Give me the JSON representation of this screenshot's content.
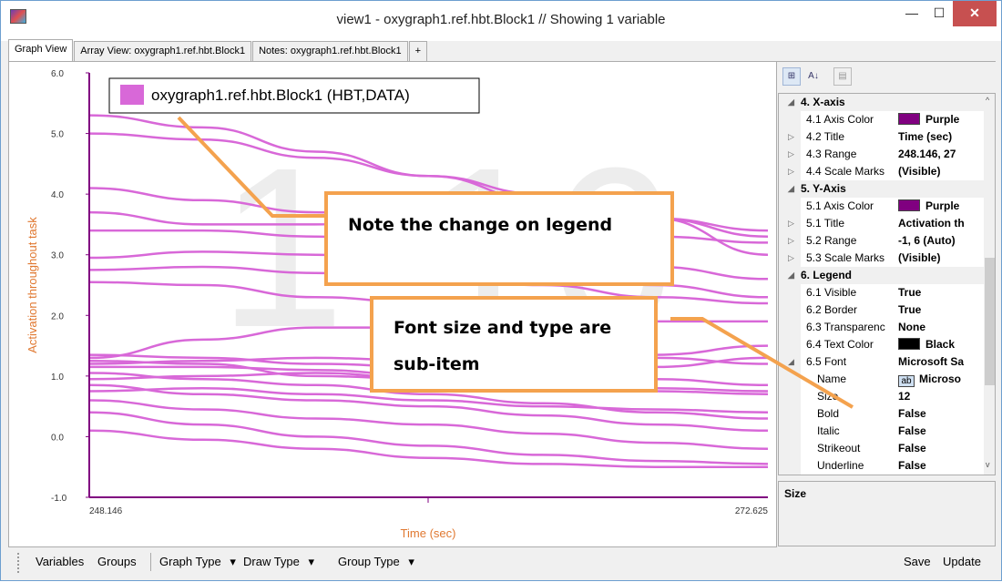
{
  "window": {
    "title": "view1 - oxygraph1.ref.hbt.Block1 // Showing 1 variable",
    "minimize": "—",
    "maximize": "☐",
    "close": "✕"
  },
  "tabs": [
    {
      "label": "Graph View"
    },
    {
      "label": "Array View: oxygraph1.ref.hbt.Block1"
    },
    {
      "label": "Notes: oxygraph1.ref.hbt.Block1"
    },
    {
      "label": "+"
    }
  ],
  "chart_data": {
    "type": "line",
    "legend_label": "oxygraph1.ref.hbt.Block1 (HBT,DATA)",
    "legend_placement": "top-left",
    "xlabel": "Time (sec)",
    "ylabel": "Activation throughout task",
    "x_ticks": [
      "248.146",
      "272.625"
    ],
    "y_ticks": [
      "6.0",
      "5.0",
      "4.0",
      "3.0",
      "2.0",
      "1.0",
      "0.0",
      "-1.0"
    ],
    "xlim": [
      248.146,
      272.625
    ],
    "ylim": [
      -1,
      6
    ],
    "watermark": "1-16",
    "line_color": "#d868d8",
    "axis_color": "#800080",
    "series": [
      {
        "values": [
          5.3,
          5.1,
          4.7,
          4.3,
          3.9,
          3.6,
          3.4
        ]
      },
      {
        "values": [
          5.0,
          4.9,
          4.6,
          4.3,
          4.0,
          3.6,
          3.0
        ]
      },
      {
        "values": [
          4.1,
          3.9,
          3.7,
          3.6,
          3.5,
          3.3,
          3.2
        ]
      },
      {
        "values": [
          3.7,
          3.5,
          3.5,
          3.7,
          3.9,
          3.6,
          3.3
        ]
      },
      {
        "values": [
          3.4,
          3.4,
          3.3,
          3.1,
          3.0,
          2.8,
          2.6
        ]
      },
      {
        "values": [
          2.95,
          3.05,
          3.0,
          2.9,
          2.7,
          2.5,
          2.3
        ]
      },
      {
        "values": [
          2.75,
          2.8,
          2.7,
          2.6,
          2.5,
          2.3,
          2.2
        ]
      },
      {
        "values": [
          2.55,
          2.5,
          2.3,
          2.2,
          2.0,
          1.9,
          1.9
        ]
      },
      {
        "values": [
          1.3,
          1.6,
          1.8,
          1.8,
          1.6,
          1.3,
          1.2
        ]
      },
      {
        "values": [
          1.35,
          1.3,
          1.2,
          1.15,
          1.2,
          1.35,
          1.5
        ]
      },
      {
        "values": [
          1.25,
          1.2,
          1.0,
          0.95,
          1.0,
          1.15,
          1.3
        ]
      },
      {
        "values": [
          1.15,
          1.15,
          1.1,
          1.0,
          0.9,
          0.8,
          0.75
        ]
      },
      {
        "values": [
          1.05,
          0.95,
          0.85,
          0.7,
          0.55,
          0.4,
          0.3
        ]
      },
      {
        "values": [
          0.95,
          1.0,
          1.05,
          0.95,
          0.85,
          0.75,
          0.7
        ]
      },
      {
        "values": [
          0.85,
          0.7,
          0.6,
          0.5,
          0.35,
          0.2,
          0.1
        ]
      },
      {
        "values": [
          0.75,
          0.8,
          0.7,
          0.6,
          0.5,
          0.45,
          0.4
        ]
      },
      {
        "values": [
          0.6,
          0.45,
          0.3,
          0.2,
          0.05,
          -0.1,
          -0.2
        ]
      },
      {
        "values": [
          0.4,
          0.2,
          0.0,
          -0.15,
          -0.3,
          -0.4,
          -0.45
        ]
      },
      {
        "values": [
          0.1,
          -0.05,
          -0.2,
          -0.35,
          -0.45,
          -0.5,
          -0.5
        ]
      },
      {
        "values": [
          1.2,
          1.25,
          1.3,
          1.25,
          1.1,
          0.95,
          0.85
        ]
      }
    ]
  },
  "callouts": [
    {
      "text": "Note the change on legend"
    },
    {
      "line1": "Font size and type are",
      "line2": "sub-item"
    }
  ],
  "properties": {
    "rows": [
      {
        "kind": "cat",
        "exp": "◢",
        "name": "4. X-axis",
        "value": ""
      },
      {
        "kind": "prop",
        "exp": "",
        "name": "4.1 Axis Color",
        "value": "Purple",
        "swatch": "#800080"
      },
      {
        "kind": "prop",
        "exp": "▷",
        "name": "4.2 Title",
        "value": "Time (sec)"
      },
      {
        "kind": "prop",
        "exp": "▷",
        "name": "4.3 Range",
        "value": "248.146, 27"
      },
      {
        "kind": "prop",
        "exp": "▷",
        "name": "4.4 Scale Marks",
        "value": "(Visible)"
      },
      {
        "kind": "cat",
        "exp": "◢",
        "name": "5. Y-Axis",
        "value": ""
      },
      {
        "kind": "prop",
        "exp": "",
        "name": "5.1 Axis Color",
        "value": "Purple",
        "swatch": "#800080"
      },
      {
        "kind": "prop",
        "exp": "▷",
        "name": "5.1 Title",
        "value": "Activation th"
      },
      {
        "kind": "prop",
        "exp": "▷",
        "name": "5.2 Range",
        "value": "-1, 6 (Auto)"
      },
      {
        "kind": "prop",
        "exp": "▷",
        "name": "5.3 Scale Marks",
        "value": "(Visible)"
      },
      {
        "kind": "cat",
        "exp": "◢",
        "name": "6. Legend",
        "value": ""
      },
      {
        "kind": "prop",
        "exp": "",
        "name": "6.1 Visible",
        "value": "True"
      },
      {
        "kind": "prop",
        "exp": "",
        "name": "6.2 Border",
        "value": "True"
      },
      {
        "kind": "prop",
        "exp": "",
        "name": "6.3 Transparenc",
        "value": "None"
      },
      {
        "kind": "prop",
        "exp": "",
        "name": "6.4 Text Color",
        "value": "Black",
        "swatch": "#000000"
      },
      {
        "kind": "prop",
        "exp": "◢",
        "name": "6.5 Font",
        "value": "Microsoft Sa"
      },
      {
        "kind": "sub",
        "exp": "",
        "name": "Name",
        "value": "Microso",
        "ab": "ab"
      },
      {
        "kind": "sub",
        "exp": "",
        "name": "Size",
        "value": "12"
      },
      {
        "kind": "sub",
        "exp": "",
        "name": "Bold",
        "value": "False"
      },
      {
        "kind": "sub",
        "exp": "",
        "name": "Italic",
        "value": "False"
      },
      {
        "kind": "sub",
        "exp": "",
        "name": "Strikeout",
        "value": "False"
      },
      {
        "kind": "sub",
        "exp": "",
        "name": "Underline",
        "value": "False"
      }
    ],
    "help_title": "Size"
  },
  "statusbar": {
    "variables": "Variables",
    "groups": "Groups",
    "graph_type": "Graph Type",
    "draw_type": "Draw Type",
    "group_type": "Group Type",
    "dropdown_arrow": "▾",
    "save": "Save",
    "update": "Update"
  },
  "side_toolbar": {
    "categorized": "⊞",
    "alphabetical": "A↓",
    "pages": "▤"
  }
}
